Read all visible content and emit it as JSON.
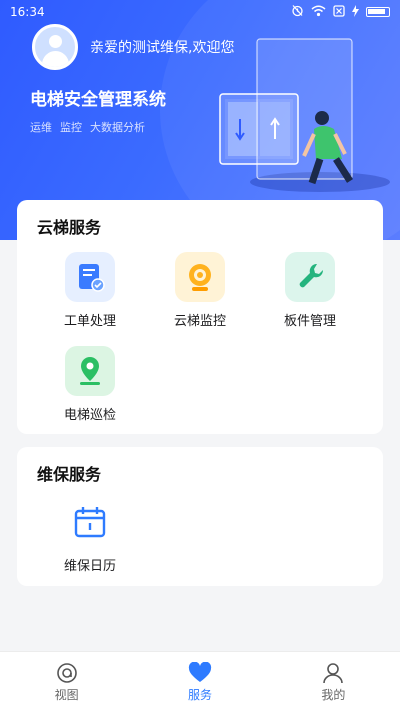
{
  "status_bar": {
    "time": "16:34"
  },
  "header": {
    "welcome": "亲爱的测试维保,欢迎您",
    "system_title": "电梯安全管理系统",
    "tags": [
      "运维",
      "监控",
      "大数据分析"
    ]
  },
  "cloud_services": {
    "title": "云梯服务",
    "items": [
      {
        "label": "工单处理",
        "icon": "work-order-icon"
      },
      {
        "label": "云梯监控",
        "icon": "camera-icon"
      },
      {
        "label": "板件管理",
        "icon": "wrench-icon"
      },
      {
        "label": "电梯巡检",
        "icon": "location-pin-icon"
      }
    ]
  },
  "maintenance_services": {
    "title": "维保服务",
    "items": [
      {
        "label": "维保日历",
        "icon": "calendar-icon"
      }
    ]
  },
  "tabbar": {
    "items": [
      {
        "label": "视图",
        "icon": "view-icon",
        "active": false
      },
      {
        "label": "服务",
        "icon": "heart-icon",
        "active": true
      },
      {
        "label": "我的",
        "icon": "user-icon",
        "active": false
      }
    ]
  },
  "colors": {
    "brand_blue": "#2f5bff",
    "active_tab": "#2e7bff",
    "background": "#f4f5f7"
  }
}
